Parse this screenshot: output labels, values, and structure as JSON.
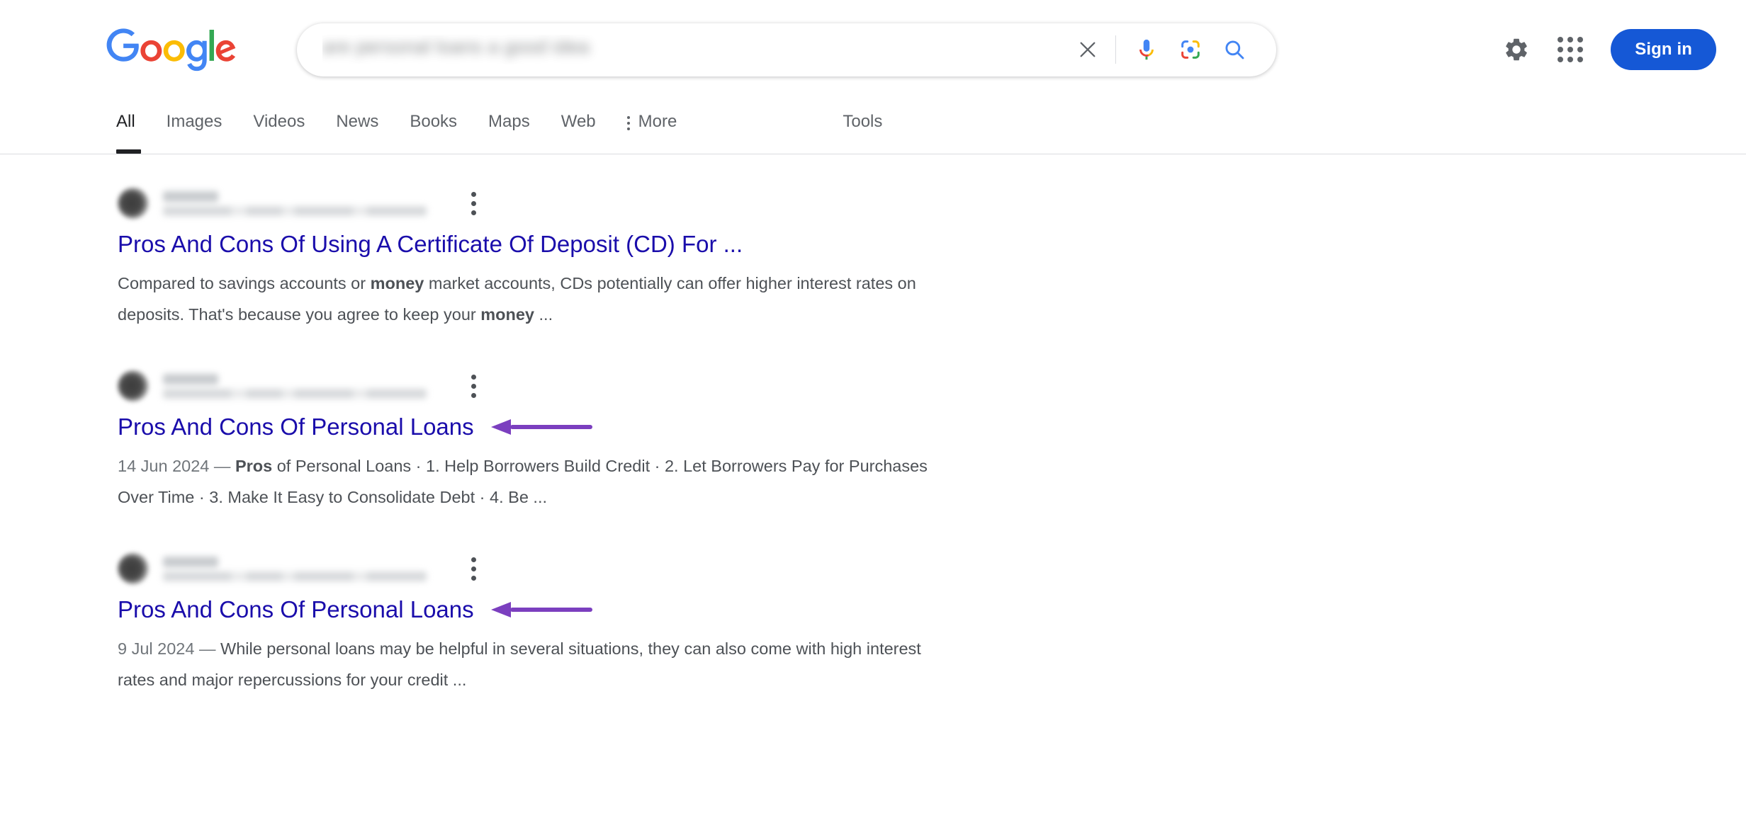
{
  "header": {
    "logo_alt": "Google",
    "search": {
      "value": "are personal loans a good idea",
      "placeholder": "Search",
      "clear_label": "Clear",
      "voice_label": "Search by voice",
      "lens_label": "Search by image",
      "search_label": "Google Search"
    },
    "settings_label": "Settings",
    "apps_label": "Google apps",
    "signin_label": "Sign in"
  },
  "nav": {
    "tabs": [
      {
        "label": "All",
        "active": true
      },
      {
        "label": "Images",
        "active": false
      },
      {
        "label": "Videos",
        "active": false
      },
      {
        "label": "News",
        "active": false
      },
      {
        "label": "Books",
        "active": false
      },
      {
        "label": "Maps",
        "active": false
      },
      {
        "label": "Web",
        "active": false
      }
    ],
    "more_label": "More",
    "tools_label": "Tools"
  },
  "results": [
    {
      "site_name": "",
      "site_url": "",
      "title": "Pros And Cons Of Using A Certificate Of Deposit (CD) For ...",
      "snippet_parts": [
        {
          "text": "Compared to savings accounts or ",
          "style": "normal"
        },
        {
          "text": "money",
          "style": "bold"
        },
        {
          "text": " market accounts, CDs potentially can offer higher interest rates on deposits. That's because you agree to keep your ",
          "style": "normal"
        },
        {
          "text": "money",
          "style": "bold"
        },
        {
          "text": " ...",
          "style": "normal"
        }
      ],
      "annotated": false
    },
    {
      "site_name": "",
      "site_url": "",
      "title": "Pros And Cons Of Personal Loans",
      "snippet_parts": [
        {
          "text": "14 Jun 2024 — ",
          "style": "date"
        },
        {
          "text": "Pros",
          "style": "bold"
        },
        {
          "text": " of Personal Loans · 1. Help Borrowers Build Credit · 2. Let Borrowers Pay for Purchases Over Time · 3. Make It Easy to Consolidate Debt · 4. Be ...",
          "style": "normal"
        }
      ],
      "annotated": true
    },
    {
      "site_name": "",
      "site_url": "",
      "title": "Pros And Cons Of Personal Loans",
      "snippet_parts": [
        {
          "text": "9 Jul 2024 — ",
          "style": "date"
        },
        {
          "text": "While personal loans may be helpful in several situations, they can also come with high interest rates and major repercussions for your credit ...",
          "style": "normal"
        }
      ],
      "annotated": true
    }
  ],
  "annotation": {
    "arrow_color": "#7B3FBF",
    "direction": "left",
    "count": 2
  },
  "colors": {
    "link": "#1a0dab",
    "snippet_text": "#4d5156",
    "muted": "#70757a",
    "accent_blue": "#1558d6",
    "google_blue": "#4285f4",
    "google_red": "#ea4335",
    "google_yellow": "#fbbc05",
    "google_green": "#34a853",
    "tab_active": "#202124",
    "icon_gray": "#5f6368"
  }
}
